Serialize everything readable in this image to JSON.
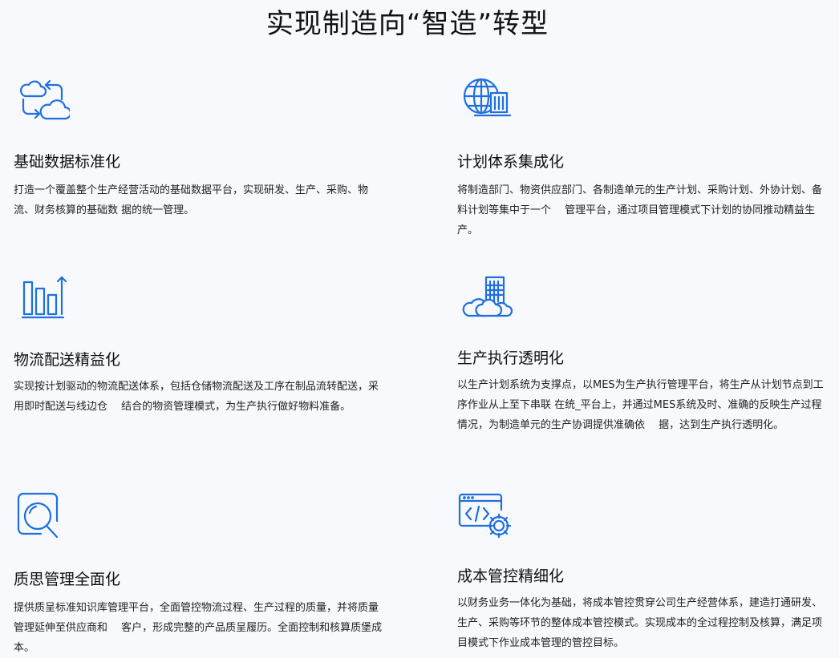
{
  "page": {
    "title": "实现制造向“智造”转型"
  },
  "colors": {
    "accent": "#1f6fe0",
    "background": "#f7f9fd",
    "text": "#111111"
  },
  "features": [
    {
      "icon": "cloud-sync-icon",
      "title": "基础数据标准化",
      "description": "打造一个覆盖整个生产经营活动的基础数据平台，实现研发、生产、采购、物流、财务核算的基础数 据的统一管理。"
    },
    {
      "icon": "globe-building-icon",
      "title": "计划体系集成化",
      "description": "将制造部门、物资供应部门、各制造单元的生产计划、采购计划、外协计划、备料计划等集中于一个　 管理平台，通过项目管理模式下计划的协同推动精益生产。"
    },
    {
      "icon": "bar-chart-up-icon",
      "title": "物流配送精益化",
      "description": "实现按计划驱动的物流配送体系，包括仓储物流配送及工序在制品流转配送，采用即时配送与线边仓　 结合的物资管理模式，为生产执行做好物料准备。"
    },
    {
      "icon": "cloud-building-icon",
      "title": "生产执行透明化",
      "description": "以生产计划系统为支撑点，以MES为生产执行管理平台，将生产从计划节点到工序作业从上至下串联 在统_平台上，并通过MES系统及时、准确的反映生产过程情况，为制造单元的生产协调提供准确依　 据，达到生产执行透明化。"
    },
    {
      "icon": "magnifier-icon",
      "title": "质思管理全面化",
      "description": "提供质呈标准知识库管理平台，全面管控物流过程、生产过程的质量，并将质量管理延伸至供应商和　 客户，形成完整的产品质呈履历。全面控制和核算质堡成本。"
    },
    {
      "icon": "code-gear-icon",
      "title": "成本管控精细化",
      "description": "以财务业务一体化为基础，将成本管控贯穿公司生产经营体系，建造打通研发、生产、采购等环节的整体成本管控模式。实现成本的全过程控制及核算，满足项目模式下作业成本管理的管控目标。"
    }
  ]
}
